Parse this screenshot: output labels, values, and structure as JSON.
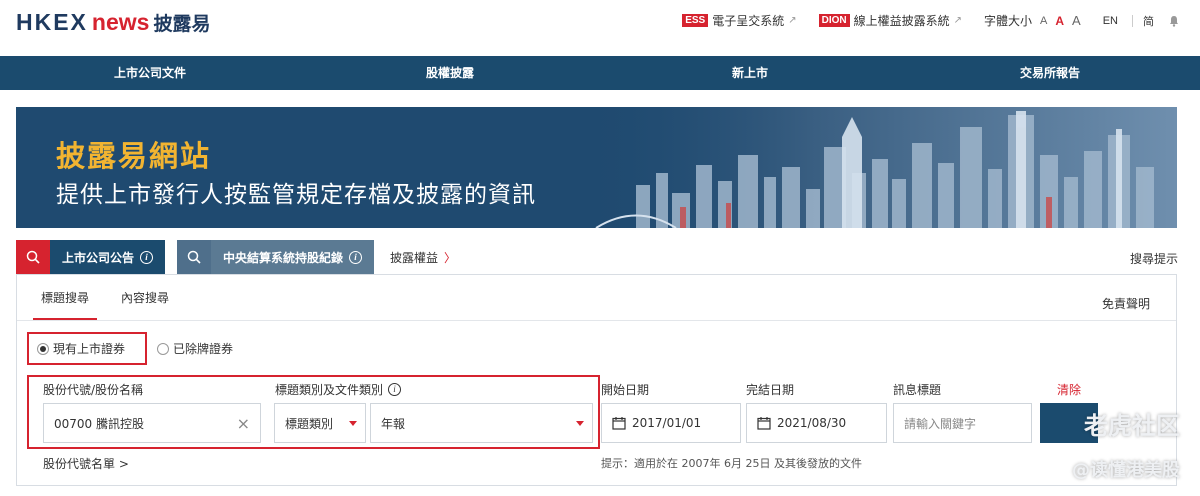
{
  "header": {
    "logo_hkex": "HKEX",
    "logo_news": "news",
    "logo_cn": "披露易",
    "ess_badge": "ESS",
    "ess_label": "電子呈交系統",
    "dion_badge": "DION",
    "dion_label": "線上權益披露系統",
    "font_size_label": "字體大小",
    "font_a": "A",
    "lang_en": "EN",
    "lang_simplified": "简"
  },
  "nav": [
    "上市公司文件",
    "股權披露",
    "新上市",
    "交易所報告"
  ],
  "banner": {
    "title": "披露易網站",
    "subtitle": "提供上市發行人按監管規定存檔及披露的資訊"
  },
  "search_tabs": {
    "listed_announcements": "上市公司公告",
    "ccass": "中央結算系統持股紀錄",
    "disclosure_of_interests": "披露權益",
    "disclosure_arrow": "〉",
    "search_tips": "搜尋提示"
  },
  "panel": {
    "tab_title_search": "標題搜尋",
    "tab_content_search": "內容搜尋",
    "disclaimer": "免責聲明",
    "radio_current": "現有上市證券",
    "radio_delisted": "已除牌證券",
    "stock_label": "股份代號/股份名稱",
    "stock_value": "00700 騰訊控股",
    "category_label": "標題類別及文件類別",
    "category_value": "標題類別",
    "doc_type_value": "年報",
    "start_date_label": "開始日期",
    "start_date_value": "2017/01/01",
    "end_date_label": "完結日期",
    "end_date_value": "2021/08/30",
    "headline_label": "訊息標題",
    "headline_placeholder": "請輸入關鍵字",
    "clear": "清除",
    "stock_list": "股份代號名單 >",
    "hint": "提示：適用於在 2007年 6月 25日 及其後發放的文件"
  },
  "watermark": {
    "line1": "老虎社区",
    "line2": "@读懂港美股"
  },
  "colors": {
    "brand_navy": "#1b4b6e",
    "brand_red": "#d6232f",
    "banner_gold": "#f2b431"
  }
}
